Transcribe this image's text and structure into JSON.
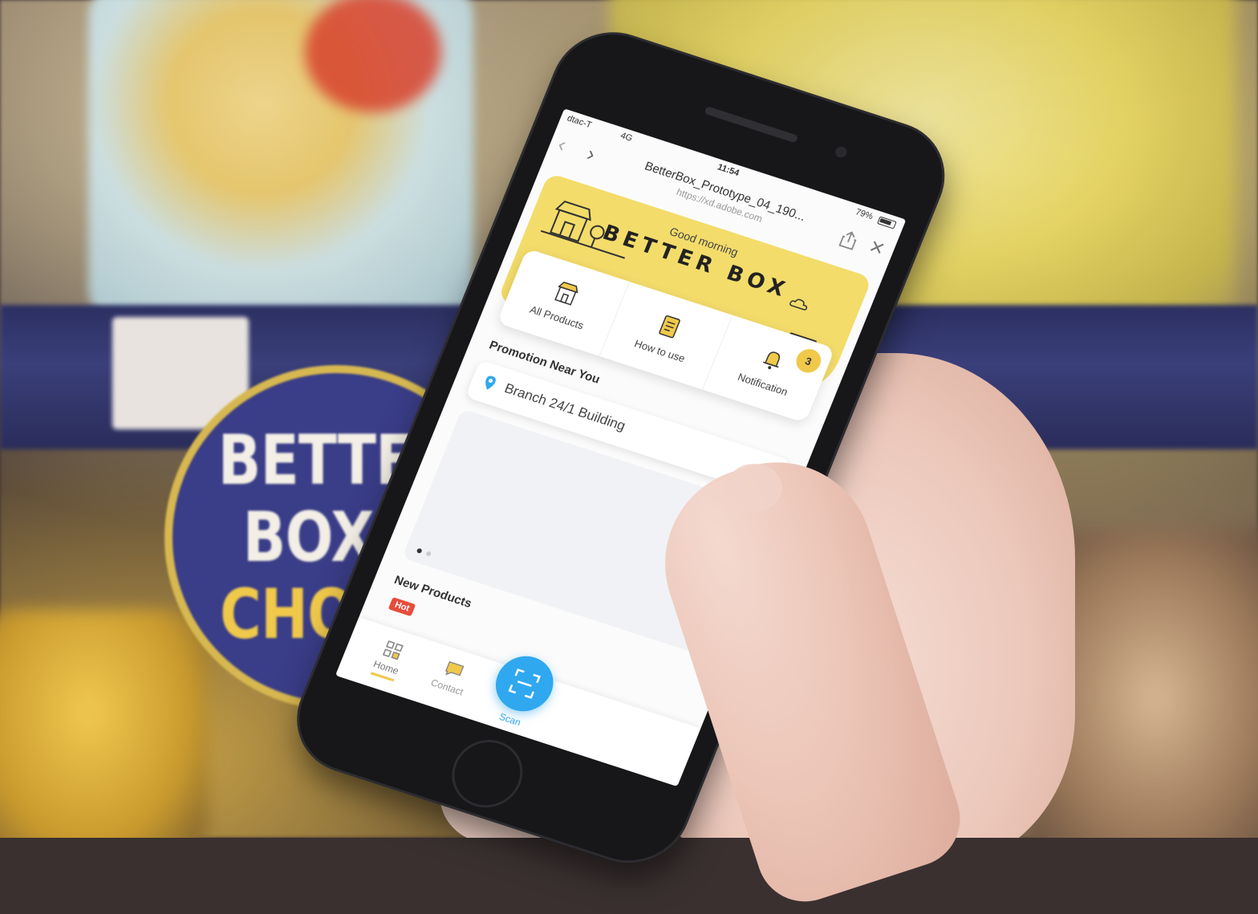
{
  "scene": {
    "badge_lines": [
      "BETTER",
      "BOX'S",
      "CHOICE"
    ]
  },
  "status_bar": {
    "carrier": "dtac-T",
    "network": "4G",
    "time": "11:54",
    "battery": "79%"
  },
  "browser": {
    "page_title": "BetterBox_Prototype_04_190...",
    "url": "https://xd.adobe.com"
  },
  "app": {
    "greeting": "Good morning",
    "brand": "BETTER BOX",
    "accent_color": "#f3dc6a",
    "scan_color": "#2fa8f0",
    "quick_menu": [
      {
        "label": "All Products",
        "icon": "store-icon"
      },
      {
        "label": "How to use",
        "icon": "document-icon"
      },
      {
        "label": "Notification",
        "icon": "bell-icon",
        "count": "3"
      }
    ],
    "promotion_title": "Promotion Near You",
    "branch": "Branch 24/1 Building",
    "new_products_title": "New Products",
    "hot_tag": "Hot",
    "bottom_nav": {
      "home": "Home",
      "contact": "Contact",
      "scan": "Scan"
    }
  }
}
